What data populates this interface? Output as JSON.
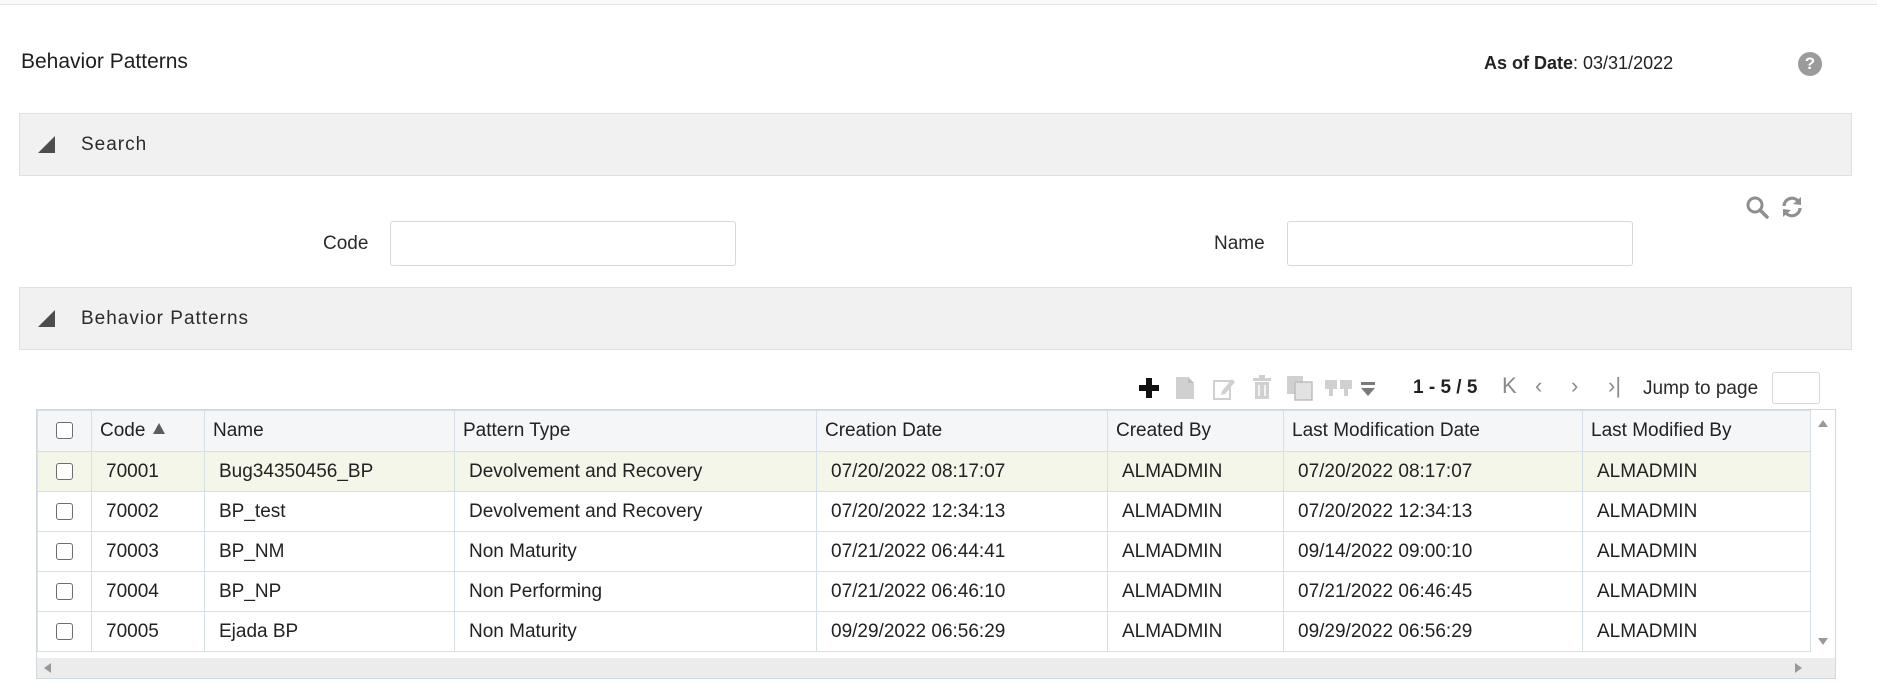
{
  "header": {
    "title": "Behavior Patterns",
    "as_of_label": "As of Date",
    "as_of_value": ": 03/31/2022",
    "help_icon": "question-circle-icon"
  },
  "search_section": {
    "label": "Search",
    "code_label": "Code",
    "code_value": "",
    "name_label": "Name",
    "name_value": "",
    "icons": [
      "search-icon",
      "refresh-icon"
    ]
  },
  "list_section": {
    "label": "Behavior Patterns"
  },
  "toolbar": {
    "icons": [
      "add-icon",
      "view-icon",
      "edit-icon",
      "delete-icon",
      "copy-icon",
      "compare-icon",
      "more-dropdown-icon"
    ],
    "pager_text": "1 - 5 / 5",
    "jump_label": "Jump to page",
    "jump_value": ""
  },
  "grid": {
    "columns": [
      "Code",
      "Name",
      "Pattern Type",
      "Creation Date",
      "Created By",
      "Last Modification Date",
      "Last Modified By"
    ],
    "sorted_column": "Code",
    "sort_direction": "ascending",
    "rows": [
      [
        "70001",
        "Bug34350456_BP",
        "Devolvement and Recovery",
        "07/20/2022 08:17:07",
        "ALMADMIN",
        "07/20/2022 08:17:07",
        "ALMADMIN"
      ],
      [
        "70002",
        "BP_test",
        "Devolvement and Recovery",
        "07/20/2022 12:34:13",
        "ALMADMIN",
        "07/20/2022 12:34:13",
        "ALMADMIN"
      ],
      [
        "70003",
        "BP_NM",
        "Non Maturity",
        "07/21/2022 06:44:41",
        "ALMADMIN",
        "09/14/2022 09:00:10",
        "ALMADMIN"
      ],
      [
        "70004",
        "BP_NP",
        "Non Performing",
        "07/21/2022 06:46:10",
        "ALMADMIN",
        "07/21/2022 06:46:45",
        "ALMADMIN"
      ],
      [
        "70005",
        "Ejada BP",
        "Non Maturity",
        "09/29/2022 06:56:29",
        "ALMADMIN",
        "09/29/2022 06:56:29",
        "ALMADMIN"
      ]
    ]
  },
  "colors": {
    "section_bg": "#f1f1f1",
    "selected_row": "#f4f6e9",
    "icon_gray": "#9b9b9b"
  }
}
